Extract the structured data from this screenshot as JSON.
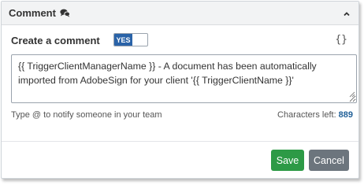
{
  "header": {
    "title": "Comment",
    "icon": "chat-bubbles-icon",
    "collapse_icon": "chevron-up-icon"
  },
  "comment": {
    "create_label": "Create a comment",
    "toggle_value": "YES",
    "template_icon_glyph": "{}",
    "text": "{{ TriggerClientManagerName }} - A document has been automatically imported from AdobeSign for your client '{{ TriggerClientName }}'",
    "hint": "Type @ to notify someone in your team",
    "chars_left_label": "Characters left:",
    "chars_left_value": "889"
  },
  "actions": {
    "save_label": "Save",
    "cancel_label": "Cancel"
  },
  "colors": {
    "toggle_on": "#2a63a8",
    "save": "#2d9a46",
    "cancel": "#6c757d",
    "count": "#1f5f97"
  }
}
